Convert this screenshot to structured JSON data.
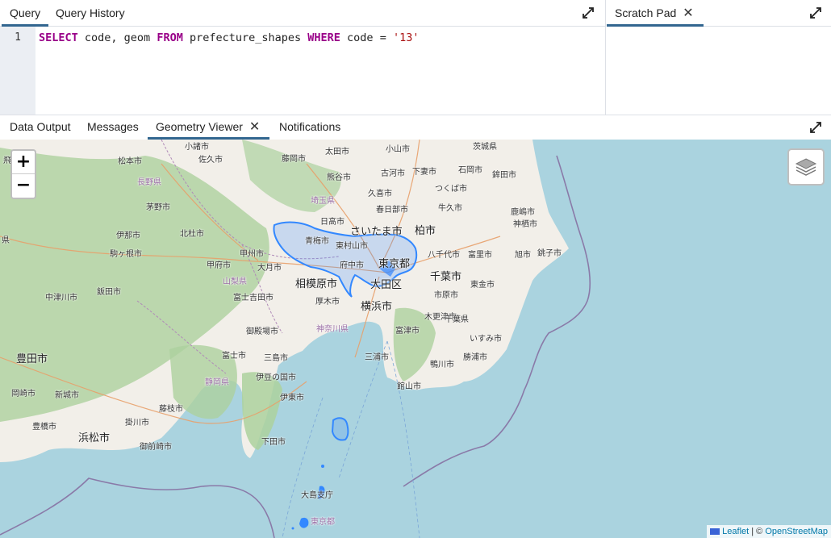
{
  "query_panel": {
    "tabs": [
      "Query",
      "Query History"
    ],
    "active_tab": "Query",
    "line_number": "1",
    "sql": {
      "kw1": "SELECT",
      "part1": " code, geom ",
      "kw2": "FROM",
      "part2": " prefecture_shapes ",
      "kw3": "WHERE",
      "part3": " code = ",
      "literal": "'13'"
    }
  },
  "scratch_panel": {
    "tab_label": "Scratch Pad",
    "close_glyph": "✕"
  },
  "results_panel": {
    "tabs": [
      "Data Output",
      "Messages",
      "Geometry Viewer",
      "Notifications"
    ],
    "active_tab": "Geometry Viewer",
    "close_glyph": "✕"
  },
  "map": {
    "zoom_in": "+",
    "zoom_out": "−",
    "attribution": {
      "leaflet": "Leaflet",
      "sep": " | © ",
      "osm": "OpenStreetMap"
    },
    "colors": {
      "sea": "#aad3df",
      "land": "#f2efe9",
      "forest": "#add19e",
      "geometry": "#3388ff"
    },
    "labels": [
      "小諸市",
      "佐久市",
      "藤岡市",
      "太田市",
      "小山市",
      "茨城県",
      "松本市",
      "熊谷市",
      "古河市",
      "下妻市",
      "石岡市",
      "鉾田市",
      "長野県",
      "埼玉県",
      "久喜市",
      "つくば市",
      "茅野市",
      "春日部市",
      "牛久市",
      "鹿嶋市",
      "伊那市",
      "北杜市",
      "日高市",
      "さいたま市",
      "柏市",
      "神栖市",
      "駒ヶ根市",
      "青梅市",
      "東村山市",
      "八千代市",
      "富里市",
      "旭市",
      "銚子市",
      "甲府市",
      "甲州市",
      "大月市",
      "府中市",
      "東京都",
      "千葉市",
      "東金市",
      "飯田市",
      "山梨県",
      "相模原市",
      "大田区",
      "中津川市",
      "富士吉田市",
      "厚木市",
      "横浜市",
      "市原市",
      "木更津市",
      "千葉県",
      "御殿場市",
      "神奈川県",
      "富津市",
      "いすみ市",
      "豊田市",
      "富士市",
      "三島市",
      "三浦市",
      "勝浦市",
      "鴨川市",
      "静岡県",
      "伊豆の国市",
      "館山市",
      "岡崎市",
      "新城市",
      "伊東市",
      "藤枝市",
      "豊橋市",
      "掛川市",
      "浜松市",
      "御前崎市",
      "下田市",
      "大島支庁",
      "東京都",
      "飛",
      "県"
    ]
  }
}
